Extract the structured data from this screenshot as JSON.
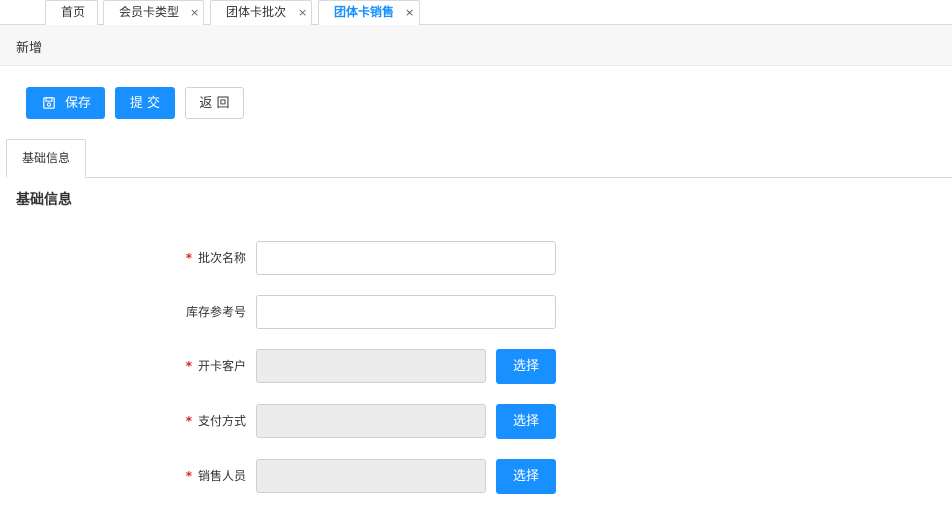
{
  "tabs": [
    {
      "label": "首页",
      "closable": false,
      "active": false
    },
    {
      "label": "会员卡类型",
      "closable": true,
      "active": false
    },
    {
      "label": "团体卡批次",
      "closable": true,
      "active": false
    },
    {
      "label": "团体卡销售",
      "closable": true,
      "active": true
    }
  ],
  "close_glyph": "×",
  "page": {
    "title": "新增"
  },
  "toolbar": {
    "save_label": "保存",
    "submit_label": "提 交",
    "back_label": "返 回"
  },
  "panel_tab": {
    "label": "基础信息"
  },
  "section": {
    "title": "基础信息"
  },
  "form": {
    "batch_name": {
      "label": "批次名称",
      "required": true,
      "value": ""
    },
    "stock_ref": {
      "label": "库存参考号",
      "required": false,
      "value": ""
    },
    "customer": {
      "label": "开卡客户",
      "required": true,
      "value": "",
      "button": "选择"
    },
    "payment": {
      "label": "支付方式",
      "required": true,
      "value": "",
      "button": "选择"
    },
    "salesperson": {
      "label": "销售人员",
      "required": true,
      "value": "",
      "button": "选择"
    }
  },
  "required_mark": "*",
  "colors": {
    "primary": "#1890ff",
    "required": "#e02020",
    "disabled_bg": "#ececec"
  }
}
